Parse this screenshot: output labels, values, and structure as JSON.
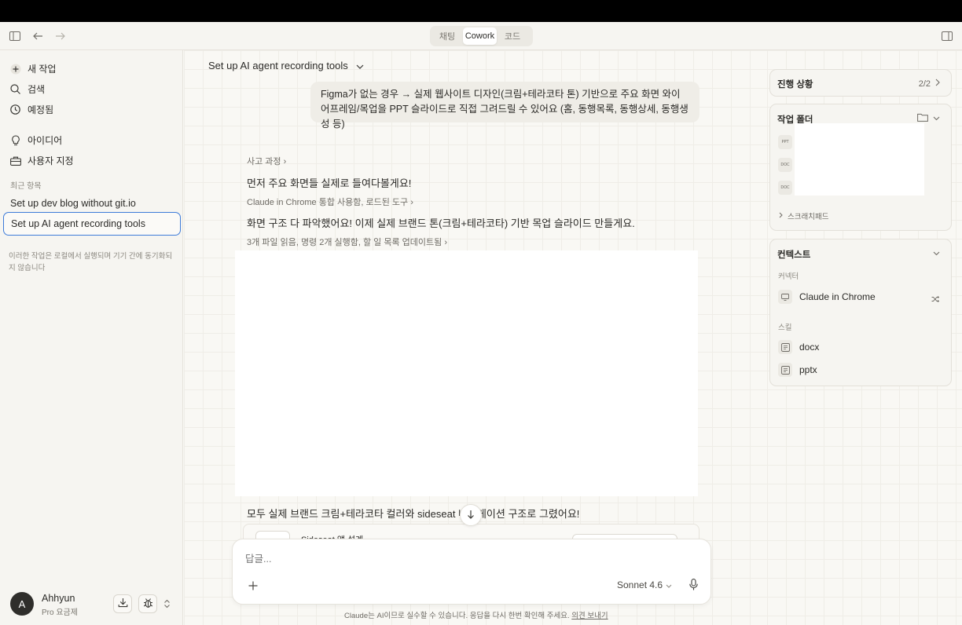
{
  "header": {
    "segments": [
      {
        "label": "채팅",
        "active": false
      },
      {
        "label": "Cowork",
        "active": true
      },
      {
        "label": "코드",
        "active": false
      }
    ]
  },
  "sidebar": {
    "nav": [
      {
        "label": "새 작업",
        "icon": "plus-icon"
      },
      {
        "label": "검색",
        "icon": "search-icon"
      },
      {
        "label": "예정됨",
        "icon": "clock-icon"
      },
      {
        "label": "아이디어",
        "icon": "lightbulb-icon"
      },
      {
        "label": "사용자 지정",
        "icon": "briefcase-icon"
      }
    ],
    "recent_label": "최근 항목",
    "recent": [
      {
        "label": "Set up dev blog without git.io",
        "active": false
      },
      {
        "label": "Set up AI agent recording tools",
        "active": true
      }
    ],
    "sync_note": "이러한 작업은 로컬에서 실행되며 기기 간에 동기화되지 않습니다",
    "user": {
      "initial": "A",
      "name": "Ahhyun",
      "plan": "Pro 요금제"
    }
  },
  "main": {
    "title": "Set up AI agent recording tools",
    "user_message": "Figma가 없는 경우 → 실제 웹사이트 디자인(크림+테라코타 톤) 기반으로 주요 화면 와이어프레임/목업을 PPT 슬라이드로 직접 그려드릴 수 있어요 (홈, 동행목록, 동행상세, 동행생성 등)",
    "thought_process": "사고 과정",
    "line1": "먼저 주요 화면들 실제로 들여다볼게요!",
    "tool1": "Claude in Chrome 통합 사용함, 로드된 도구",
    "line2": "화면 구조 다 파악했어요! 이제 실제 브랜드 톤(크림+테라코타) 기반 목업 슬라이드 만들게요.",
    "tool2": "3개 파일 읽음, 명령 2개 실행함, 할 일 목록 업데이트됨",
    "line3": "모두 실제 브랜드 크림+테라코타 컬러와 sideseat 네비게이션 구조로 그렸어요!",
    "peek_card_title": "Sideseat 앱 설계",
    "composer": {
      "placeholder": "답글...",
      "model": "Sonnet 4.6"
    },
    "disclaimer": "Claude는 AI이므로 실수할 수 있습니다. 응답을 다시 한번 확인해 주세요.",
    "feedback_link": "의견 보내기"
  },
  "right_panel": {
    "progress": {
      "title": "진행 상황",
      "count": "2/2"
    },
    "folder": {
      "title": "작업 폴더",
      "files": [
        {
          "type": "PPT"
        },
        {
          "type": "DOC"
        },
        {
          "type": "DOC"
        }
      ],
      "scratchpad": "스크래치패드"
    },
    "context": {
      "title": "컨텍스트",
      "connectors_label": "커넥터",
      "connector": "Claude in Chrome",
      "skills_label": "스킬",
      "skills": [
        "docx",
        "pptx"
      ]
    }
  },
  "colors": {
    "accent_focus": "#3d7bd9",
    "background": "#f9f8f4"
  }
}
